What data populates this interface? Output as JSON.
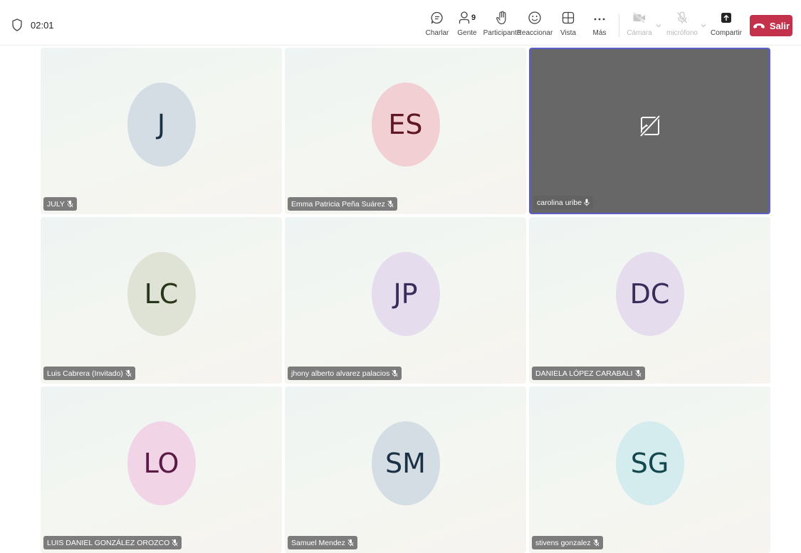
{
  "meeting": {
    "timer": "02:01"
  },
  "toolbar": {
    "chat_label": "Charlar",
    "people_label": "Gente",
    "people_count": "9",
    "raise_hand_label": "Participante",
    "react_label": "Reaccionar",
    "view_label": "Vista",
    "more_label": "Más",
    "camera_label": "Cámara",
    "mic_label": "micrófono",
    "share_label": "Compartir",
    "leave_label": "Salir"
  },
  "colors": {
    "leave": "#c4314b",
    "active_speaker_border": "#5b5fc7",
    "video_off_bg": "#676767"
  },
  "participants": [
    {
      "initials": "J",
      "name": "JULY",
      "avatar_bg": "#d3dde3",
      "initials_color": "#1b3045",
      "mic": "muted"
    },
    {
      "initials": "ES",
      "name": "Emma Patricia Peña Suárez",
      "avatar_bg": "#f2cfd2",
      "initials_color": "#5e1723",
      "mic": "muted"
    },
    {
      "initials": "",
      "name": "carolina uribe",
      "avatar_bg": "",
      "initials_color": "",
      "mic": "on",
      "camera_off": true
    },
    {
      "initials": "LC",
      "name": "Luis Cabrera (Invitado)",
      "avatar_bg": "#dfe3d6",
      "initials_color": "#27351a",
      "mic": "muted"
    },
    {
      "initials": "JP",
      "name": "jhony alberto alvarez palacios",
      "avatar_bg": "#e5dcee",
      "initials_color": "#3a2b5a",
      "mic": "muted"
    },
    {
      "initials": "DC",
      "name": "DANIELA LÓPEZ CARABALI",
      "avatar_bg": "#e5dcee",
      "initials_color": "#3a2b5a",
      "mic": "muted"
    },
    {
      "initials": "LO",
      "name": "LUIS DANIEL GONZÁLEZ OROZCO",
      "avatar_bg": "#f1d5e6",
      "initials_color": "#5b1a45",
      "mic": "muted"
    },
    {
      "initials": "SM",
      "name": "Samuel Mendez",
      "avatar_bg": "#d3dde3",
      "initials_color": "#1b3045",
      "mic": "muted"
    },
    {
      "initials": "SG",
      "name": "stivens gonzalez",
      "avatar_bg": "#d5ecef",
      "initials_color": "#12474e",
      "mic": "muted"
    }
  ]
}
